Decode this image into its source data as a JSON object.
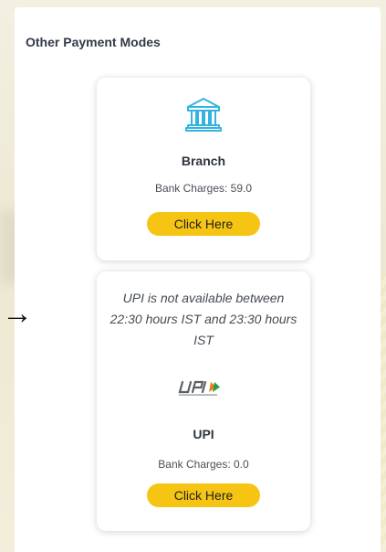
{
  "section": {
    "title": "Other Payment Modes"
  },
  "cards": [
    {
      "icon": "bank-building-icon",
      "title": "Branch",
      "charges": "Bank Charges: 59.0",
      "button_label": "Click Here"
    },
    {
      "notice": "UPI is not available between 22:30 hours IST and 23:30 hours IST",
      "icon": "upi-logo-icon",
      "title": "UPI",
      "charges": "Bank Charges: 0.0",
      "button_label": "Click Here"
    }
  ],
  "annotation": {
    "arrow": "→"
  },
  "colors": {
    "button": "#f6c514",
    "bank_icon": "#35b3e0",
    "title_text": "#333b48"
  }
}
